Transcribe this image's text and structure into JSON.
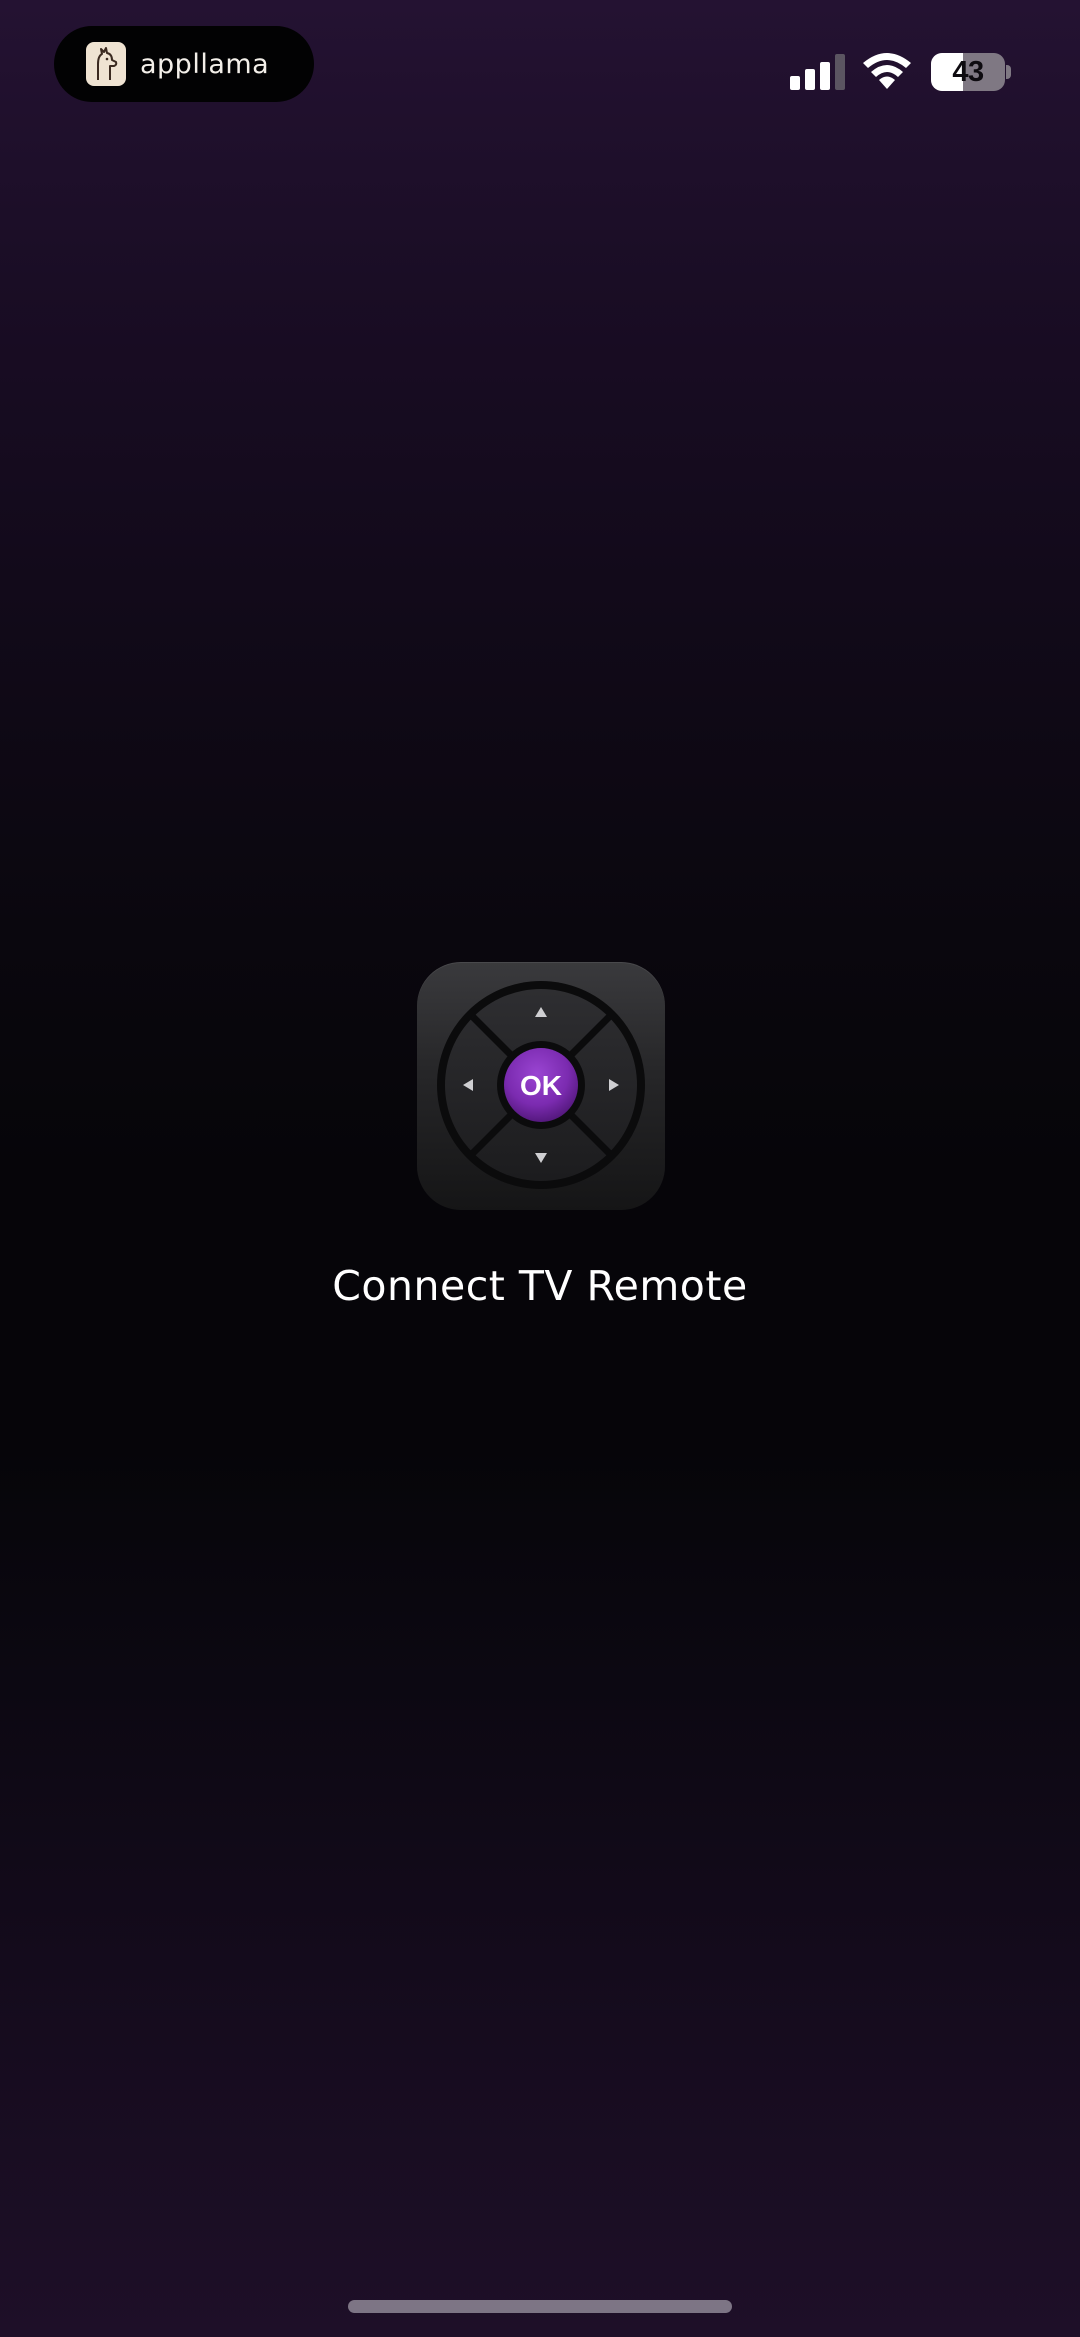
{
  "status_bar": {
    "watermark_text": "appllama",
    "battery_level": "43",
    "battery_percent": 43,
    "signal_bars_active": 3,
    "signal_bars_total": 4
  },
  "splash": {
    "app_icon": "tv-remote-dpad-icon",
    "ok_label": "OK",
    "title": "Connect TV Remote",
    "accent_color": "#7b2bb0"
  },
  "colors": {
    "background_top": "#241232",
    "background_middle": "#060509",
    "background_bottom": "#1e0f28",
    "text": "#ffffff"
  }
}
